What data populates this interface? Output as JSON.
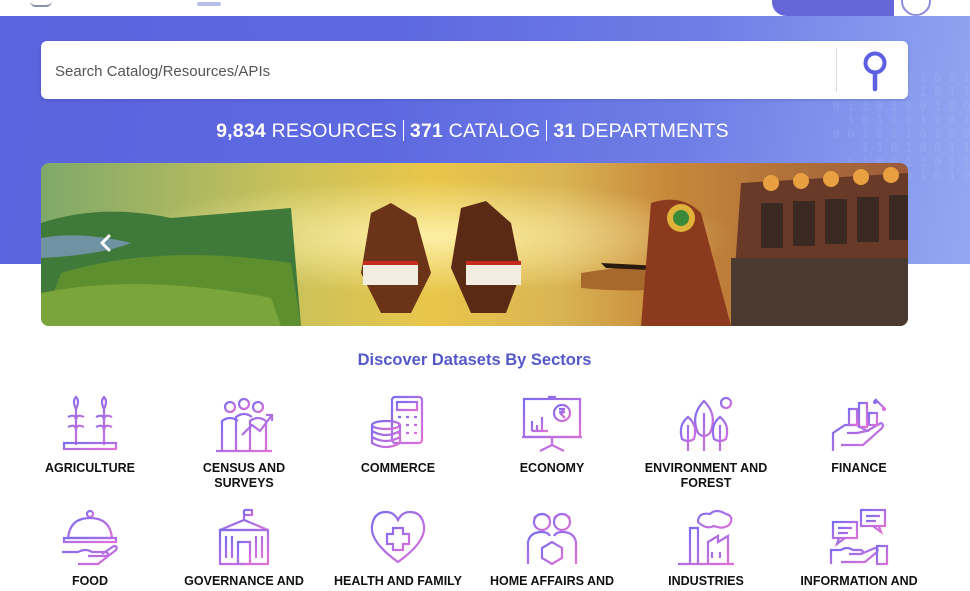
{
  "search": {
    "placeholder": "Search Catalog/Resources/APIs"
  },
  "stats": {
    "resources_count": "9,834",
    "resources_label": "RESOURCES",
    "catalog_count": "371",
    "catalog_label": "CATALOG",
    "departments_count": "31",
    "departments_label": "DEPARTMENTS"
  },
  "sectors_title": "Discover Datasets By Sectors",
  "sectors": [
    {
      "label": "AGRICULTURE",
      "icon": "agriculture-icon"
    },
    {
      "label": "CENSUS AND SURVEYS",
      "icon": "census-icon"
    },
    {
      "label": "COMMERCE",
      "icon": "commerce-icon"
    },
    {
      "label": "ECONOMY",
      "icon": "economy-icon"
    },
    {
      "label": "ENVIRONMENT AND FOREST",
      "icon": "environment-icon"
    },
    {
      "label": "FINANCE",
      "icon": "finance-icon"
    },
    {
      "label": "FOOD",
      "icon": "food-icon"
    },
    {
      "label": "GOVERNANCE AND",
      "icon": "governance-icon"
    },
    {
      "label": "HEALTH AND FAMILY",
      "icon": "health-icon"
    },
    {
      "label": "HOME AFFAIRS AND",
      "icon": "home-affairs-icon"
    },
    {
      "label": "INDUSTRIES",
      "icon": "industries-icon"
    },
    {
      "label": "INFORMATION AND",
      "icon": "information-icon"
    }
  ],
  "colors": {
    "accent": "#5b63de",
    "icon_gradient_start": "#7b6cf0",
    "icon_gradient_end": "#e070d8"
  }
}
